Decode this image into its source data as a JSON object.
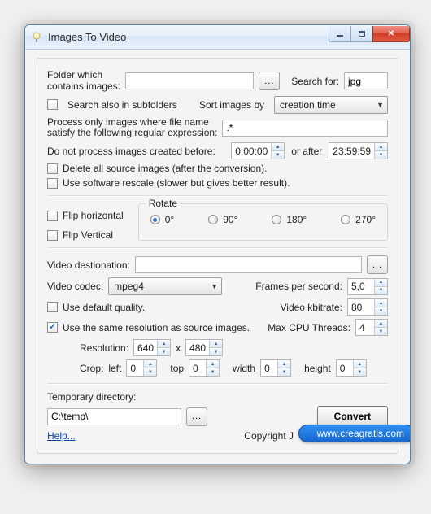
{
  "window": {
    "title": "Images To Video"
  },
  "labels": {
    "folder_which": "Folder which",
    "contains_images": "contains images:",
    "search_for": "Search for:",
    "search_subfolders": "Search also in subfolders",
    "sort_images_by": "Sort images by",
    "regex1": "Process only images where file name",
    "regex2": "satisfy the following regular expression:",
    "not_before": "Do not process images created before:",
    "or_after": "or after",
    "delete_source": "Delete all source images (after the conversion).",
    "software_rescale": "Use software rescale (slower but gives better result).",
    "flip_h": "Flip horizontal",
    "flip_v": "Flip Vertical",
    "rotate": "Rotate",
    "rot0": "0°",
    "rot90": "90°",
    "rot180": "180°",
    "rot270": "270°",
    "video_dest": "Video destionation:",
    "video_codec": "Video codec:",
    "fps": "Frames per second:",
    "use_default_quality": "Use default quality.",
    "kbitrate": "Video kbitrate:",
    "same_resolution": "Use the same resolution as source images.",
    "max_cpu": "Max CPU Threads:",
    "resolution": "Resolution:",
    "x": "x",
    "crop": "Crop:",
    "left": "left",
    "top": "top",
    "width": "width",
    "height": "height",
    "temp_dir": "Temporary directory:",
    "convert": "Convert",
    "help": "Help...",
    "copyright": "Copyright J",
    "browse": "..."
  },
  "values": {
    "folder": "",
    "search_for": "jpg",
    "sort_by": "creation time",
    "regex": ".*",
    "time_before": "0:00:00",
    "time_after": "23:59:59",
    "video_dest": "",
    "codec": "mpeg4",
    "fps": "5,0",
    "kbitrate": "80",
    "max_cpu": "4",
    "res_w": "640",
    "res_h": "480",
    "crop_left": "0",
    "crop_top": "0",
    "crop_width": "0",
    "crop_height": "0",
    "temp_dir": "C:\\temp\\"
  },
  "checks": {
    "subfolders": false,
    "delete_source": false,
    "software_rescale": false,
    "flip_h": false,
    "flip_v": false,
    "default_quality": false,
    "same_resolution": true
  },
  "rotate_selected": "0",
  "watermark": "www.creagratis.com"
}
